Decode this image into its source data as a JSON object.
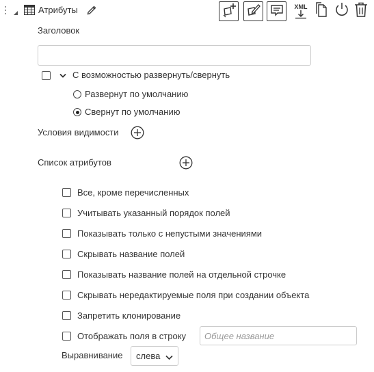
{
  "header": {
    "title": "Атрибуты"
  },
  "title_field": {
    "label": "Заголовок",
    "value": ""
  },
  "collapsible": {
    "label": "С возможностью развернуть/свернуть",
    "checked": false,
    "options": [
      {
        "label": "Развернут по умолчанию",
        "selected": false
      },
      {
        "label": "Свернут по умолчанию",
        "selected": true
      }
    ]
  },
  "visibility": {
    "label": "Условия видимости"
  },
  "attributes": {
    "label": "Список атрибутов"
  },
  "options": [
    {
      "label": "Все, кроме перечисленных",
      "checked": false
    },
    {
      "label": "Учитывать указанный порядок полей",
      "checked": false
    },
    {
      "label": "Показывать только с непустыми значениями",
      "checked": false
    },
    {
      "label": "Скрывать название полей",
      "checked": false
    },
    {
      "label": "Показывать название полей на отдельной строчке",
      "checked": false
    },
    {
      "label": "Скрывать нередактируемые поля при создании объекта",
      "checked": false
    },
    {
      "label": "Запретить клонирование",
      "checked": false
    },
    {
      "label": "Отображать поля в строку",
      "checked": false
    }
  ],
  "common_name": {
    "placeholder": "Общее название",
    "value": ""
  },
  "alignment": {
    "label": "Выравнивание",
    "value": "слева"
  },
  "toolbar": {
    "xml_label": "XML",
    "icons": [
      "add-block-icon",
      "edit-block-icon",
      "comment-icon",
      "xml-download-icon",
      "copy-icon",
      "power-icon",
      "trash-icon"
    ]
  }
}
